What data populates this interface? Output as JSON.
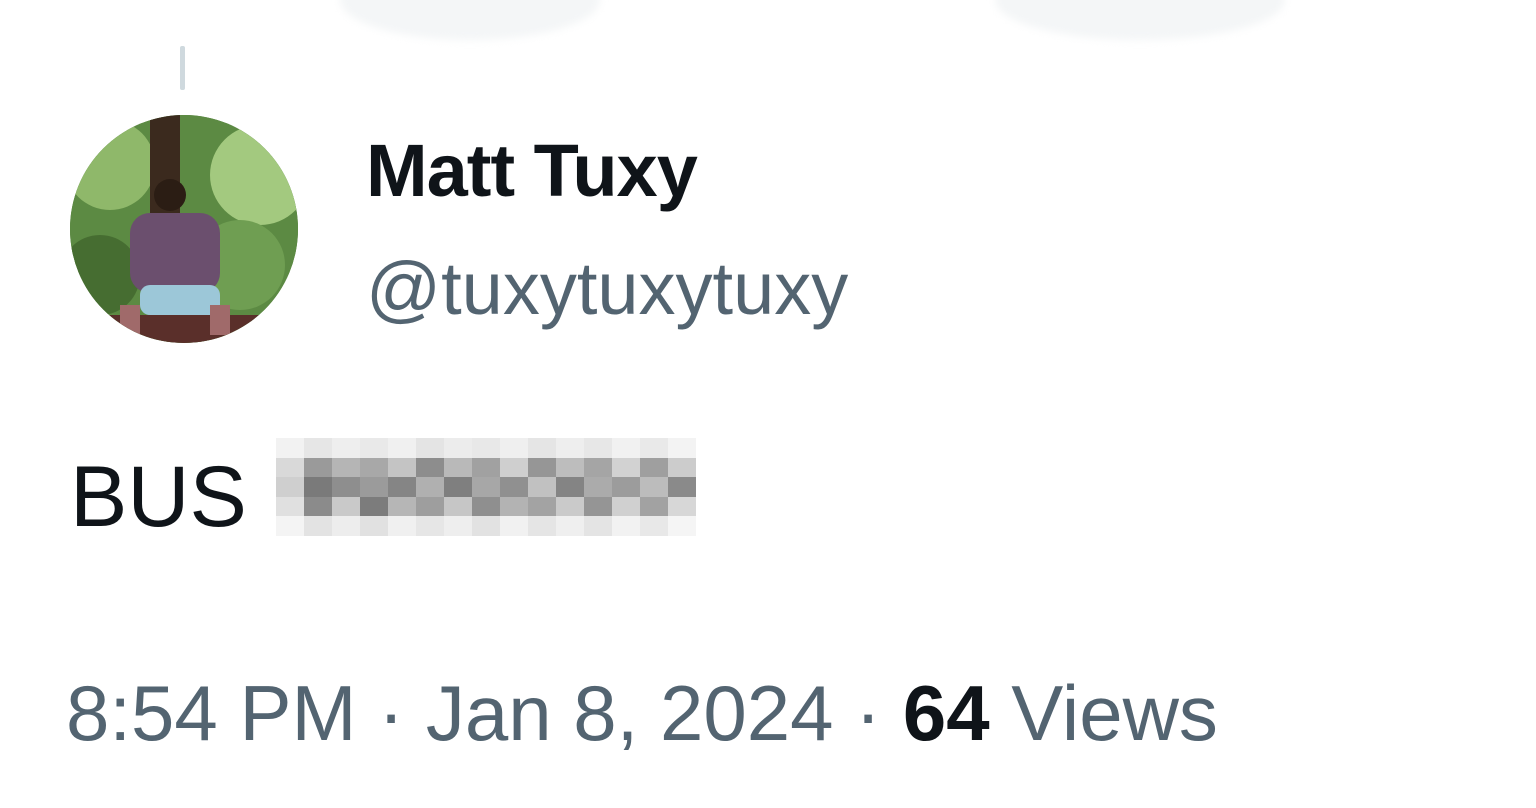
{
  "author": {
    "display_name": "Matt Tuxy",
    "handle": "@tuxytuxytuxy"
  },
  "tweet": {
    "text": "BUS"
  },
  "meta": {
    "time": "8:54 PM",
    "separator": "·",
    "date": "Jan 8, 2024",
    "views_count": "64",
    "views_label": "Views"
  },
  "colors": {
    "primary_text": "#0f1419",
    "secondary_text": "#536471",
    "thread_line": "#cfd9de"
  }
}
